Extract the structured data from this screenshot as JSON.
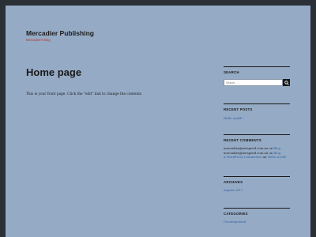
{
  "header": {
    "site_title": "Mercadier Publishing",
    "site_description": "Mercadier's blog"
  },
  "main": {
    "title": "Home page",
    "content": "This is your front page. Click the \"edit\" link to change the contents"
  },
  "sidebar": {
    "search": {
      "title": "SEARCH",
      "placeholder": "Search …",
      "icon": "search-icon"
    },
    "recent_posts": {
      "title": "RECENT POSTS",
      "items": [
        {
          "label": "Hello world!"
        }
      ]
    },
    "recent_comments": {
      "title": "RECENT COMMENTS",
      "items": [
        {
          "author": "mercadier@netspeed.com.au",
          "on": "on",
          "post": "Blog"
        },
        {
          "author": "mercadier@netspeed.com.au",
          "on": "on",
          "post": "Blog"
        },
        {
          "author": "A WordPress Commenter",
          "on": "on",
          "post": "Hello world!"
        }
      ]
    },
    "archives": {
      "title": "ARCHIVES",
      "items": [
        {
          "label": "August 2017"
        }
      ]
    },
    "categories": {
      "title": "CATEGORIES",
      "items": [
        {
          "label": "Uncategorized"
        }
      ]
    }
  },
  "colors": {
    "page_background": "#95aac4",
    "outer_background": "#2b2f36",
    "link": "#2b5fa3",
    "tagline": "#b03a3a"
  }
}
